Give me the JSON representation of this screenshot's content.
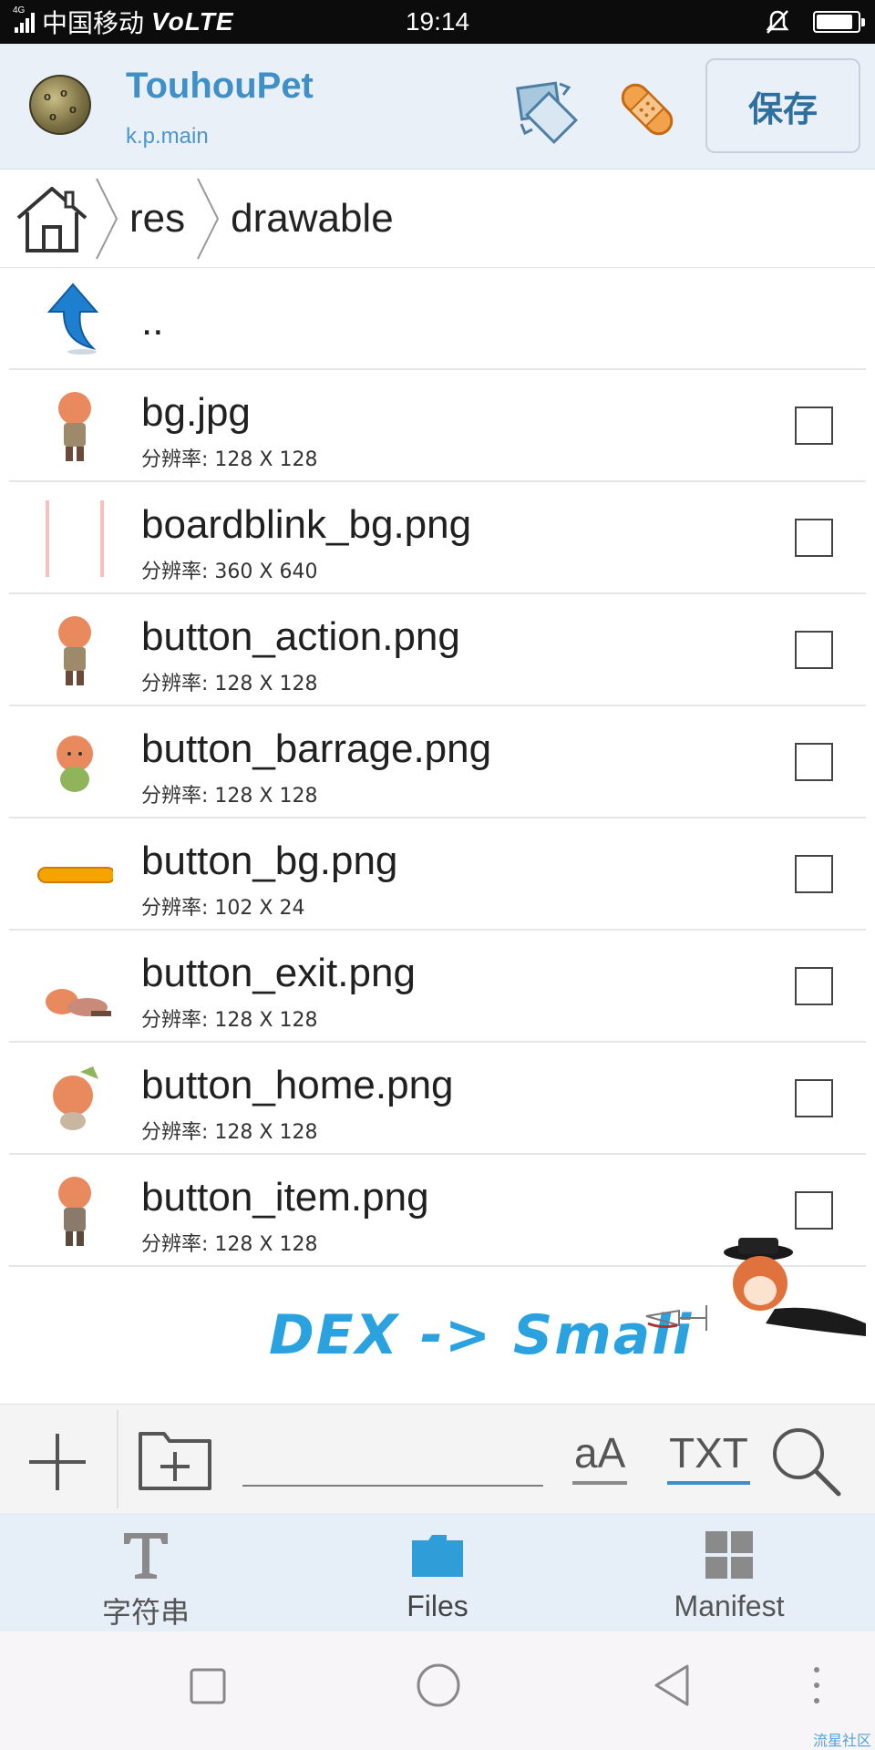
{
  "status_bar": {
    "network_type": "4G",
    "carrier": "中国移动",
    "volte": "VoLTE",
    "time": "19:14"
  },
  "app": {
    "title": "TouhouPet",
    "package": "k.p.main",
    "save_label": "保存"
  },
  "breadcrumb": [
    "res",
    "drawable"
  ],
  "parent_label": "..",
  "meta_prefix": "分辨率: ",
  "files": [
    {
      "name": "bg.jpg",
      "meta": "分辨率: 128 X 128"
    },
    {
      "name": "boardblink_bg.png",
      "meta": "分辨率: 360 X 640"
    },
    {
      "name": "button_action.png",
      "meta": "分辨率: 128 X 128"
    },
    {
      "name": "button_barrage.png",
      "meta": "分辨率: 128 X 128"
    },
    {
      "name": "button_bg.png",
      "meta": "分辨率: 102 X 24"
    },
    {
      "name": "button_exit.png",
      "meta": "分辨率: 128 X 128"
    },
    {
      "name": "button_home.png",
      "meta": "分辨率: 128 X 128"
    },
    {
      "name": "button_item.png",
      "meta": "分辨率: 128 X 128"
    }
  ],
  "banner": {
    "text": "DEX -> Smali"
  },
  "toolbar": {
    "font_size_label": "aA",
    "txt_label": "TXT",
    "search_value": ""
  },
  "bottom_nav": {
    "tabs": [
      {
        "label": "字符串",
        "icon": "text-icon"
      },
      {
        "label": "Files",
        "icon": "folder-icon",
        "active": true
      },
      {
        "label": "Manifest",
        "icon": "grid-icon"
      }
    ]
  },
  "watermark": "流星社区",
  "colors": {
    "accent": "#3f8fc8",
    "header_bg": "#eaf0f7",
    "nav_bg": "#e6eef8",
    "files_icon": "#2f9ed8"
  }
}
